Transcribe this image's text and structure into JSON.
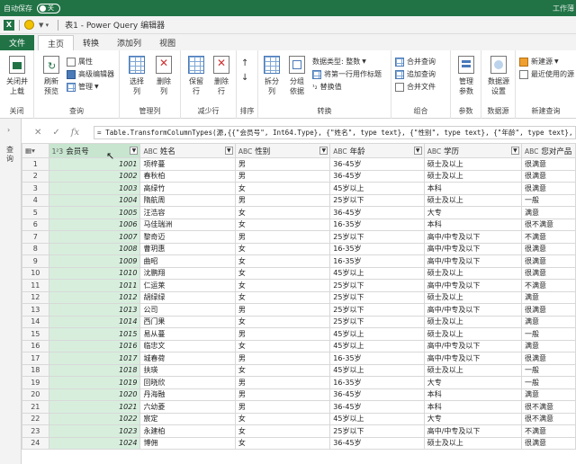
{
  "titlebar": {
    "autosave_label": "自动保存",
    "toggle_label": "关",
    "right_text": "工作薄"
  },
  "editor": {
    "title": "表1 - Power Query 编辑器"
  },
  "tabs": [
    {
      "label": "文件"
    },
    {
      "label": "主页"
    },
    {
      "label": "转换"
    },
    {
      "label": "添加列"
    },
    {
      "label": "视图"
    }
  ],
  "ribbon": {
    "close": {
      "btn1": "关闭并",
      "btn1b": "上载",
      "label": "关闭"
    },
    "query": {
      "refresh": "刷新",
      "refresh_b": "预览",
      "props": "属性",
      "adv": "高级编辑器",
      "manage": "管理",
      "label": "查询"
    },
    "cols": {
      "choose": "选择",
      "choose_b": "列",
      "remove": "删除",
      "remove_b": "列",
      "label": "管理列"
    },
    "rows": {
      "keep": "保留",
      "keep_b": "行",
      "del": "删除",
      "del_b": "行",
      "label": "减少行"
    },
    "sort": {
      "label": "排序"
    },
    "transform": {
      "split": "拆分",
      "split_b": "列",
      "group": "分组",
      "group_b": "依据",
      "dtype": "数据类型: 整数",
      "first_row": "将第一行用作标题",
      "replace": "替换值",
      "label": "转换"
    },
    "combine": {
      "merge": "合并查询",
      "append": "追加查询",
      "files": "合并文件",
      "label": "组合"
    },
    "params": {
      "manage": "管理",
      "manage_b": "参数",
      "label": "参数"
    },
    "source": {
      "settings": "数据源",
      "settings_b": "设置",
      "label": "数据源"
    },
    "newquery": {
      "new": "新建源",
      "recent": "最近使用的源",
      "label": "新建查询"
    }
  },
  "formula": "= Table.TransformColumnTypes(源,{{\"会员号\", Int64.Type}, {\"姓名\", type text}, {\"性别\", type text}, {\"年龄\", type text},",
  "query_pane": {
    "label": "查询"
  },
  "columns": [
    {
      "type": "1²3",
      "name": "会员号"
    },
    {
      "type": "ABC",
      "name": "姓名"
    },
    {
      "type": "ABC",
      "name": "性别"
    },
    {
      "type": "ABC",
      "name": "年龄"
    },
    {
      "type": "ABC",
      "name": "学历"
    },
    {
      "type": "ABC",
      "name": "您对产品"
    }
  ],
  "rows": [
    [
      "1",
      "1001",
      "项梓蔓",
      "男",
      "36-45岁",
      "硕士及以上",
      "很满意"
    ],
    [
      "2",
      "1002",
      "春秋柏",
      "男",
      "36-45岁",
      "硕士及以上",
      "很满意"
    ],
    [
      "3",
      "1003",
      "高绿竹",
      "女",
      "45岁以上",
      "本科",
      "很满意"
    ],
    [
      "4",
      "1004",
      "隋航周",
      "男",
      "25岁以下",
      "硕士及以上",
      "一般"
    ],
    [
      "5",
      "1005",
      "汪浩容",
      "女",
      "36-45岁",
      "大专",
      "满意"
    ],
    [
      "6",
      "1006",
      "马佳瑞洲",
      "女",
      "16-35岁",
      "本科",
      "很不满意"
    ],
    [
      "7",
      "1007",
      "黎奇迈",
      "男",
      "25岁以下",
      "高中/中专及以下",
      "不满意"
    ],
    [
      "8",
      "1008",
      "曹玥惠",
      "女",
      "16-35岁",
      "高中/中专及以下",
      "很满意"
    ],
    [
      "9",
      "1009",
      "曲昭",
      "女",
      "16-35岁",
      "高中/中专及以下",
      "很满意"
    ],
    [
      "10",
      "1010",
      "沈鹏翔",
      "女",
      "45岁以上",
      "硕士及以上",
      "很满意"
    ],
    [
      "11",
      "1011",
      "仁运莱",
      "女",
      "25岁以下",
      "高中/中专及以下",
      "不满意"
    ],
    [
      "12",
      "1012",
      "胡绿绿",
      "女",
      "25岁以下",
      "硕士及以上",
      "满意"
    ],
    [
      "13",
      "1013",
      "公司",
      "男",
      "25岁以下",
      "高中/中专及以下",
      "很满意"
    ],
    [
      "14",
      "1014",
      "西门果",
      "女",
      "25岁以下",
      "硕士及以上",
      "满意"
    ],
    [
      "15",
      "1015",
      "易从蔓",
      "男",
      "45岁以上",
      "硕士及以上",
      "一般"
    ],
    [
      "16",
      "1016",
      "临忠文",
      "女",
      "45岁以上",
      "高中/中专及以下",
      "满意"
    ],
    [
      "17",
      "1017",
      "城春荷",
      "男",
      "16-35岁",
      "高中/中专及以下",
      "很满意"
    ],
    [
      "18",
      "1018",
      "扶瑛",
      "女",
      "45岁以上",
      "硕士及以上",
      "一般"
    ],
    [
      "19",
      "1019",
      "回晓欣",
      "男",
      "16-35岁",
      "大专",
      "一般"
    ],
    [
      "20",
      "1020",
      "丹海融",
      "男",
      "36-45岁",
      "本科",
      "满意"
    ],
    [
      "21",
      "1021",
      "六幼菱",
      "男",
      "36-45岁",
      "本科",
      "很不满意"
    ],
    [
      "22",
      "1022",
      "宸定",
      "女",
      "45岁以上",
      "大专",
      "很不满意"
    ],
    [
      "23",
      "1023",
      "永建柏",
      "女",
      "25岁以下",
      "高中/中专及以下",
      "不满意"
    ],
    [
      "24",
      "1024",
      "博佣",
      "女",
      "36-45岁",
      "硕士及以上",
      "很满意"
    ]
  ]
}
